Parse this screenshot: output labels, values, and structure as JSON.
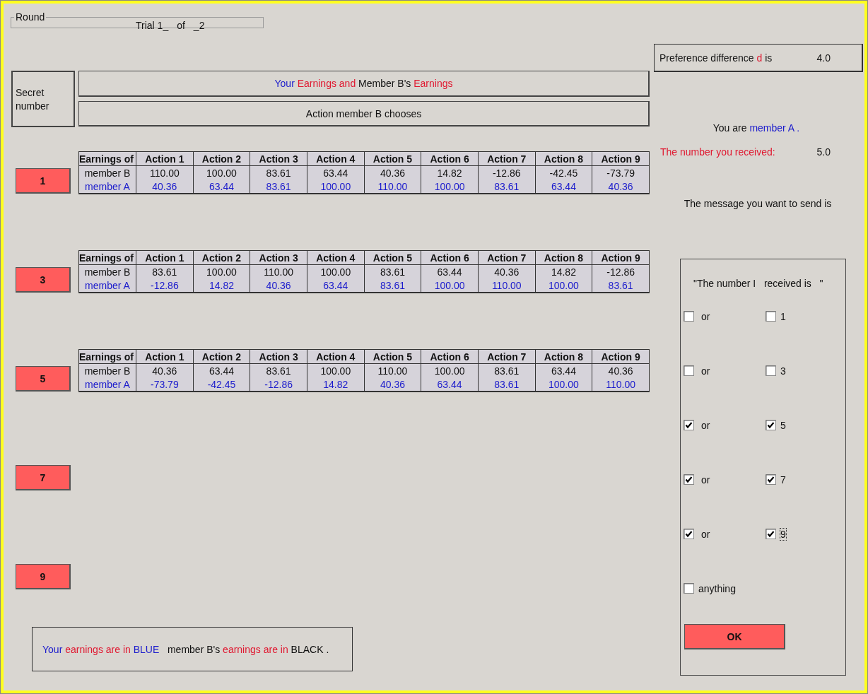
{
  "round": {
    "legend": "Round",
    "trial": "Trial 1_",
    "of": "of",
    "total": "_2"
  },
  "header": {
    "secret_label": "Secret number",
    "earnings_title": [
      {
        "text": "Your",
        "color": "#1a1acc"
      },
      {
        "text": " Earnings and ",
        "color": "#e01830"
      },
      {
        "text": "Member B's",
        "color": "#111111"
      },
      {
        "text": " Earnings",
        "color": "#e01830"
      }
    ],
    "action_title": "Action member B chooses"
  },
  "secret_rows": [
    {
      "button": "1",
      "table": {
        "corner": "Earnings of",
        "columns": [
          "Action 1",
          "Action 2",
          "Action 3",
          "Action 4",
          "Action 5",
          "Action 6",
          "Action 7",
          "Action 8",
          "Action 9"
        ],
        "rows": [
          {
            "label": "member B",
            "kind": "other",
            "values": [
              "110.00",
              "100.00",
              "83.61",
              "63.44",
              "40.36",
              "14.82",
              "-12.86",
              "-42.45",
              "-73.79"
            ]
          },
          {
            "label": "member A",
            "kind": "self",
            "values": [
              "40.36",
              "63.44",
              "83.61",
              "100.00",
              "110.00",
              "100.00",
              "83.61",
              "63.44",
              "40.36"
            ]
          }
        ]
      }
    },
    {
      "button": "3",
      "table": {
        "corner": "Earnings of",
        "columns": [
          "Action 1",
          "Action 2",
          "Action 3",
          "Action 4",
          "Action 5",
          "Action 6",
          "Action 7",
          "Action 8",
          "Action 9"
        ],
        "rows": [
          {
            "label": "member B",
            "kind": "other",
            "values": [
              "83.61",
              "100.00",
              "110.00",
              "100.00",
              "83.61",
              "63.44",
              "40.36",
              "14.82",
              "-12.86"
            ]
          },
          {
            "label": "member A",
            "kind": "self",
            "values": [
              "-12.86",
              "14.82",
              "40.36",
              "63.44",
              "83.61",
              "100.00",
              "110.00",
              "100.00",
              "83.61"
            ]
          }
        ]
      }
    },
    {
      "button": "5",
      "table": {
        "corner": "Earnings of",
        "columns": [
          "Action 1",
          "Action 2",
          "Action 3",
          "Action 4",
          "Action 5",
          "Action 6",
          "Action 7",
          "Action 8",
          "Action 9"
        ],
        "rows": [
          {
            "label": "member B",
            "kind": "other",
            "values": [
              "40.36",
              "63.44",
              "83.61",
              "100.00",
              "110.00",
              "100.00",
              "83.61",
              "63.44",
              "40.36"
            ]
          },
          {
            "label": "member A",
            "kind": "self",
            "values": [
              "-73.79",
              "-42.45",
              "-12.86",
              "14.82",
              "40.36",
              "63.44",
              "83.61",
              "100.00",
              "110.00"
            ]
          }
        ]
      }
    },
    {
      "button": "7"
    },
    {
      "button": "9"
    }
  ],
  "legend": [
    {
      "text": "Your",
      "color": "#1a1acc"
    },
    {
      "text": " earnings are in ",
      "color": "#e01830"
    },
    {
      "text": "BLUE",
      "color": "#1a1acc"
    },
    {
      "text": "   member B's ",
      "color": "#111111"
    },
    {
      "text": "earnings are in",
      "color": "#e01830"
    },
    {
      "text": " BLACK .",
      "color": "#111111"
    }
  ],
  "preference": {
    "label": [
      {
        "text": "Preference difference ",
        "color": "#111111"
      },
      {
        "text": "d",
        "color": "#e01830"
      },
      {
        "text": " is",
        "color": "#111111"
      }
    ],
    "value": "4.0"
  },
  "identity": [
    {
      "text": "You are ",
      "color": "#111111"
    },
    {
      "text": "member A .",
      "color": "#1a1acc"
    }
  ],
  "received": {
    "label": "The number you received:",
    "value": "5.0"
  },
  "message_prompt": "The message you want to send is",
  "message_panel": {
    "quote": "\"The number I   received is   \"",
    "choices": [
      {
        "or_label": "or",
        "or_checked": false,
        "value_label": "1",
        "value_checked": false,
        "focused": false
      },
      {
        "or_label": "or",
        "or_checked": false,
        "value_label": "3",
        "value_checked": false,
        "focused": false
      },
      {
        "or_label": "or",
        "or_checked": true,
        "value_label": "5",
        "value_checked": true,
        "focused": false
      },
      {
        "or_label": "or",
        "or_checked": true,
        "value_label": "7",
        "value_checked": true,
        "focused": false
      },
      {
        "or_label": "or",
        "or_checked": true,
        "value_label": "9",
        "value_checked": true,
        "focused": true
      }
    ],
    "anything": {
      "label": "anything",
      "checked": false
    },
    "ok_button": "OK"
  }
}
